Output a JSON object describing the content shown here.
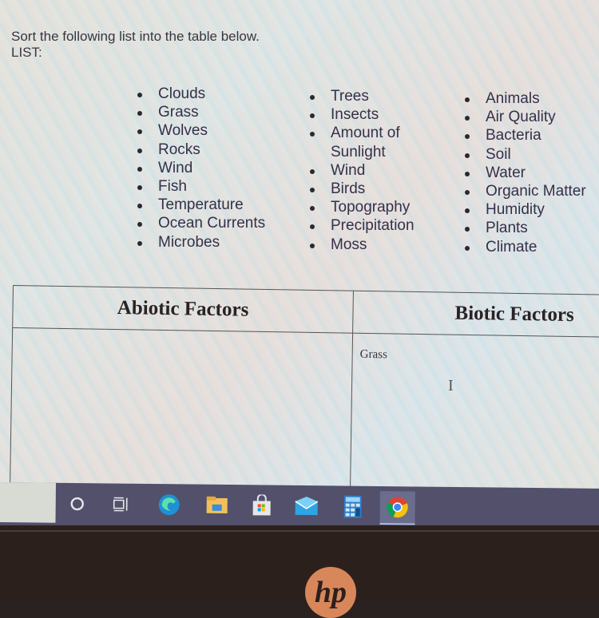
{
  "instructions": {
    "line1": "Sort the following list into the table below.",
    "line2": "LIST:"
  },
  "list": {
    "column1": [
      "Clouds",
      "Grass",
      "Wolves",
      "Rocks",
      "Wind",
      "Fish",
      "Temperature",
      "Ocean Currents",
      "Microbes"
    ],
    "column2": [
      "Trees",
      "Insects",
      "Amount of",
      "Sunlight",
      "Wind",
      "Birds",
      "Topography",
      "Precipitation",
      "Moss"
    ],
    "column3": [
      "Animals",
      "Air Quality",
      "Bacteria",
      "Soil",
      "Water",
      "Organic Matter",
      "Humidity",
      "Plants",
      "Climate"
    ]
  },
  "table": {
    "headers": [
      "Abiotic Factors",
      "Biotic Factors"
    ],
    "abiotic_entries": "",
    "biotic_entries": "Grass"
  },
  "taskbar": {
    "icons": [
      "cortana-icon",
      "task-view-icon",
      "edge-icon",
      "file-explorer-icon",
      "microsoft-store-icon",
      "mail-icon",
      "calculator-icon",
      "chrome-icon"
    ],
    "active": "chrome-icon"
  },
  "bezel": {
    "logo": "hp"
  }
}
